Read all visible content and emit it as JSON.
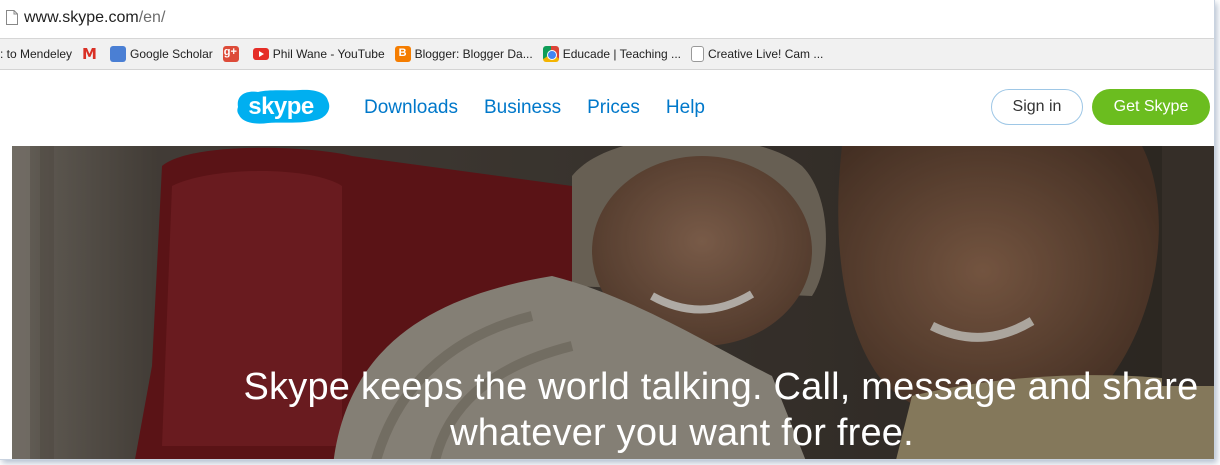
{
  "browser": {
    "url_domain": "www.skype.com",
    "url_path": "/en/"
  },
  "bookmarks": [
    {
      "label": ": to Mendeley",
      "icon": "none"
    },
    {
      "label": "",
      "icon": "gmail-icon"
    },
    {
      "label": "Google Scholar",
      "icon": "scholar-icon"
    },
    {
      "label": "",
      "icon": "google-plus-icon"
    },
    {
      "label": "Phil Wane - YouTube",
      "icon": "youtube-icon"
    },
    {
      "label": "Blogger: Blogger Da...",
      "icon": "blogger-icon"
    },
    {
      "label": "Educade | Teaching ...",
      "icon": "chrome-icon"
    },
    {
      "label": "Creative Live! Cam ...",
      "icon": "document-icon"
    }
  ],
  "nav": {
    "logo_text": "skype",
    "links": [
      "Downloads",
      "Business",
      "Prices",
      "Help"
    ],
    "signin_label": "Sign in",
    "get_skype_label": "Get Skype"
  },
  "hero": {
    "line1": "Skype keeps the world talking. Call, message and share",
    "line2": "whatever you want for free."
  },
  "colors": {
    "link_blue": "#0078ca",
    "skype_blue": "#00aff0",
    "get_skype_green": "#6bbd1f"
  }
}
